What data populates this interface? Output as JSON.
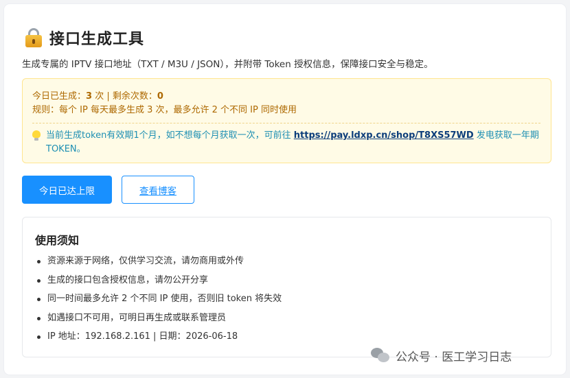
{
  "header": {
    "icon": "lock-icon",
    "title": "接口生成工具",
    "subtitle": "生成专属的 IPTV 接口地址（TXT / M3U / JSON），并附带 Token 授权信息，保障接口安全与稳定。"
  },
  "notice": {
    "generated_label": "今日已生成：",
    "generated_count": "3",
    "count_unit": " 次 | 剩余次数：",
    "remaining_count": "0",
    "rule_text": "规则：每个 IP 每天最多生成 3 次，最多允许 2 个不同 IP 同时使用",
    "tip_icon": "bulb-icon",
    "tip_text_before": "当前生成token有效期1个月，如不想每个月获取一次，可前往 ",
    "tip_link": "https://pay.ldxp.cn/shop/T8XS57WD",
    "tip_text_after": " 发电获取一年期TOKEN。",
    "colors": {
      "bg": "#fffbe6",
      "border": "#ffe58f",
      "text": "#ad6800",
      "tip": "#1d8fb3"
    }
  },
  "buttons": {
    "primary_label": "今日已达上限",
    "blog_label": "查看博客",
    "accent": "#1890ff"
  },
  "usage": {
    "title": "使用须知",
    "items": [
      "资源来源于网络，仅供学习交流，请勿商用或外传",
      "生成的接口包含授权信息，请勿公开分享",
      "同一时间最多允许 2 个不同 IP 使用，否则旧 token 将失效",
      "如遇接口不可用，可明日再生成或联系管理员",
      "IP 地址：192.168.2.161 | 日期：2026-06-18"
    ]
  },
  "watermark": {
    "icon": "wechat-icon",
    "text": "公众号 · 医工学习日志"
  }
}
